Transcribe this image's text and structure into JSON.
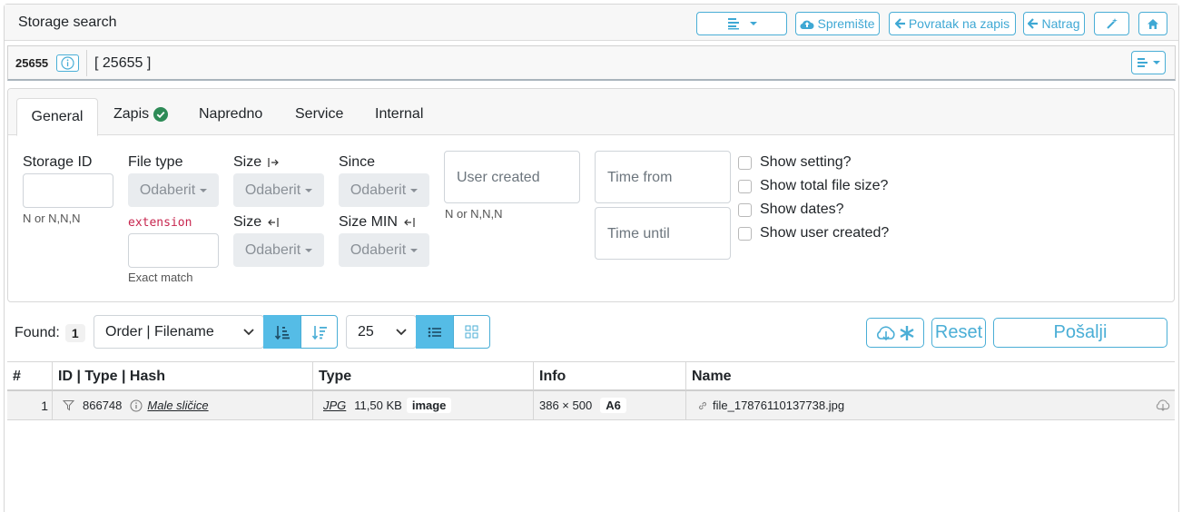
{
  "header": {
    "title": "Storage search",
    "buttons": {
      "storage": "Spremište",
      "back_to_record": "Povratak na zapis",
      "back": "Natrag"
    },
    "icons": [
      "list-dropdown-icon",
      "cloud-upload-icon",
      "arrow-left-icon",
      "arrow-left-icon",
      "magic-wand-icon",
      "home-icon"
    ]
  },
  "record": {
    "id": "25655",
    "title": "[ 25655 ]"
  },
  "tabs": [
    {
      "label": "General",
      "active": true
    },
    {
      "label": "Zapis",
      "status_icon": "check-circle-icon"
    },
    {
      "label": "Napredno"
    },
    {
      "label": "Service"
    },
    {
      "label": "Internal"
    }
  ],
  "filters": {
    "storage_id_label": "Storage ID",
    "storage_id_hint": "N or N,N,N",
    "file_type_label": "File type",
    "file_type_value": "Odaberit",
    "extension_label": "extension",
    "extension_hint": "Exact match",
    "size_from_label": "Size",
    "size_from_value": "Odaberit",
    "size_to_label": "Size",
    "size_to_value": "Odaberit",
    "since_label": "Since",
    "since_value": "Odaberit",
    "size_min_label": "Size MIN",
    "size_min_value": "Odaberit",
    "user_created_placeholder": "User created",
    "user_created_hint": "N or N,N,N",
    "time_from_placeholder": "Time from",
    "time_until_placeholder": "Time until",
    "checkboxes": [
      "Show setting?",
      "Show total file size?",
      "Show dates?",
      "Show user created?"
    ]
  },
  "results_bar": {
    "found_label": "Found:",
    "found_count": "1",
    "order_value": "Order | Filename",
    "page_size": "25",
    "reset_label": "Reset",
    "submit_label": "Pošalji"
  },
  "table": {
    "columns": [
      "#",
      "ID | Type | Hash",
      "Type",
      "Info",
      "Name"
    ],
    "rows": [
      {
        "num": "1",
        "id": "866748",
        "type_link": "Male sličice",
        "ext": "JPG",
        "size": "11,50 KB",
        "kind": "image",
        "dimensions": "386 × 500",
        "hash": "A6",
        "name": "file_17876110137738.jpg"
      }
    ]
  },
  "colors": {
    "accent": "#4aaed6",
    "accent_fill": "#55bce6",
    "success": "#2e8b57"
  }
}
